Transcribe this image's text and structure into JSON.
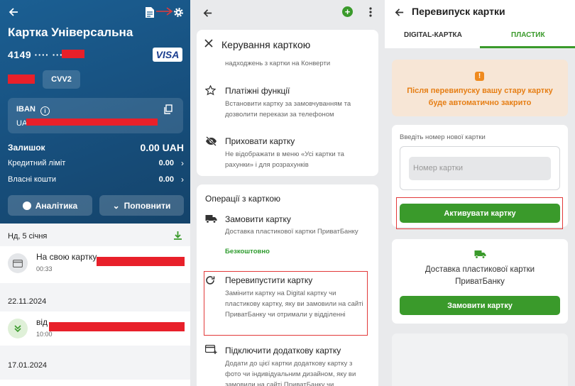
{
  "panel1": {
    "title": "Картка Універсальна",
    "card_number": "4149 ···· ····",
    "card_brand": "VISA",
    "cvv_label": "CVV2",
    "iban": {
      "label": "IBAN",
      "value": "UA"
    },
    "balance": {
      "label": "Залишок",
      "amount": "0.00 UAH"
    },
    "credit": {
      "label": "Кредитний ліміт",
      "amount": "0.00"
    },
    "own": {
      "label": "Власні кошти",
      "amount": "0.00"
    },
    "buttons": {
      "analytics": "Аналітика",
      "topup": "Поповнити"
    },
    "transactions": [
      {
        "date": "Нд, 5 січня",
        "name": "На свою картку",
        "time": "00:33"
      },
      {
        "date": "22.11.2024",
        "name": "від",
        "time": "10:00"
      },
      {
        "date": "17.01.2024"
      }
    ],
    "colors": {
      "header": "#1b5f93",
      "redaction": "#e8202a"
    }
  },
  "panel2": {
    "sheet_title": "Керування карткою",
    "partial_text": "надходжень з картки на Конверти",
    "items": [
      {
        "title": "Платіжні функції",
        "desc": "Встановити картку за замовчуванням та дозволити перекази за телефоном",
        "icon": "star-icon"
      },
      {
        "title": "Приховати картку",
        "desc": "Не відображати в меню «Усі картки та рахунки» і для розрахунків",
        "icon": "eye-off-icon"
      }
    ],
    "section_title": "Операції з карткою",
    "ops": [
      {
        "title": "Замовити картку",
        "desc": "Доставка пластикової картки ПриватБанку",
        "extra": "Безкоштовно",
        "icon": "truck-icon"
      },
      {
        "title": "Перевипустити картку",
        "desc": "Замінити картку на Digital картку чи пластикову картку, яку ви замовили на сайті ПриватБанку чи отримали у відділенні",
        "icon": "refresh-icon"
      },
      {
        "title": "Підключити додаткову картку",
        "desc": "Додати до цієї картки додаткову картку з фото чи індивідуальним дизайном, яку ви замовили на сайті ПриватБанку чи",
        "icon": "card-add-icon"
      }
    ],
    "colors": {
      "accent": "#3a9a2b",
      "highlight": "#e23a3a"
    }
  },
  "panel3": {
    "title": "Перевипуск картки",
    "tabs": [
      {
        "label": "DIGITAL-КАРТКА"
      },
      {
        "label": "ПЛАСТИК",
        "active": true
      }
    ],
    "warning": "Після перевипуску вашу стару картку буде автоматично закрито",
    "input_label": "Введіть номер нової картки",
    "input_placeholder": "Номер картки",
    "activate_button": "Активувати картку",
    "delivery_text": "Доставка пластикової картки ПриватБанку",
    "order_button": "Замовити картку",
    "colors": {
      "warning_bg": "#f7e6d6",
      "warning_text": "#e67e14",
      "button": "#3a9a2b"
    }
  }
}
